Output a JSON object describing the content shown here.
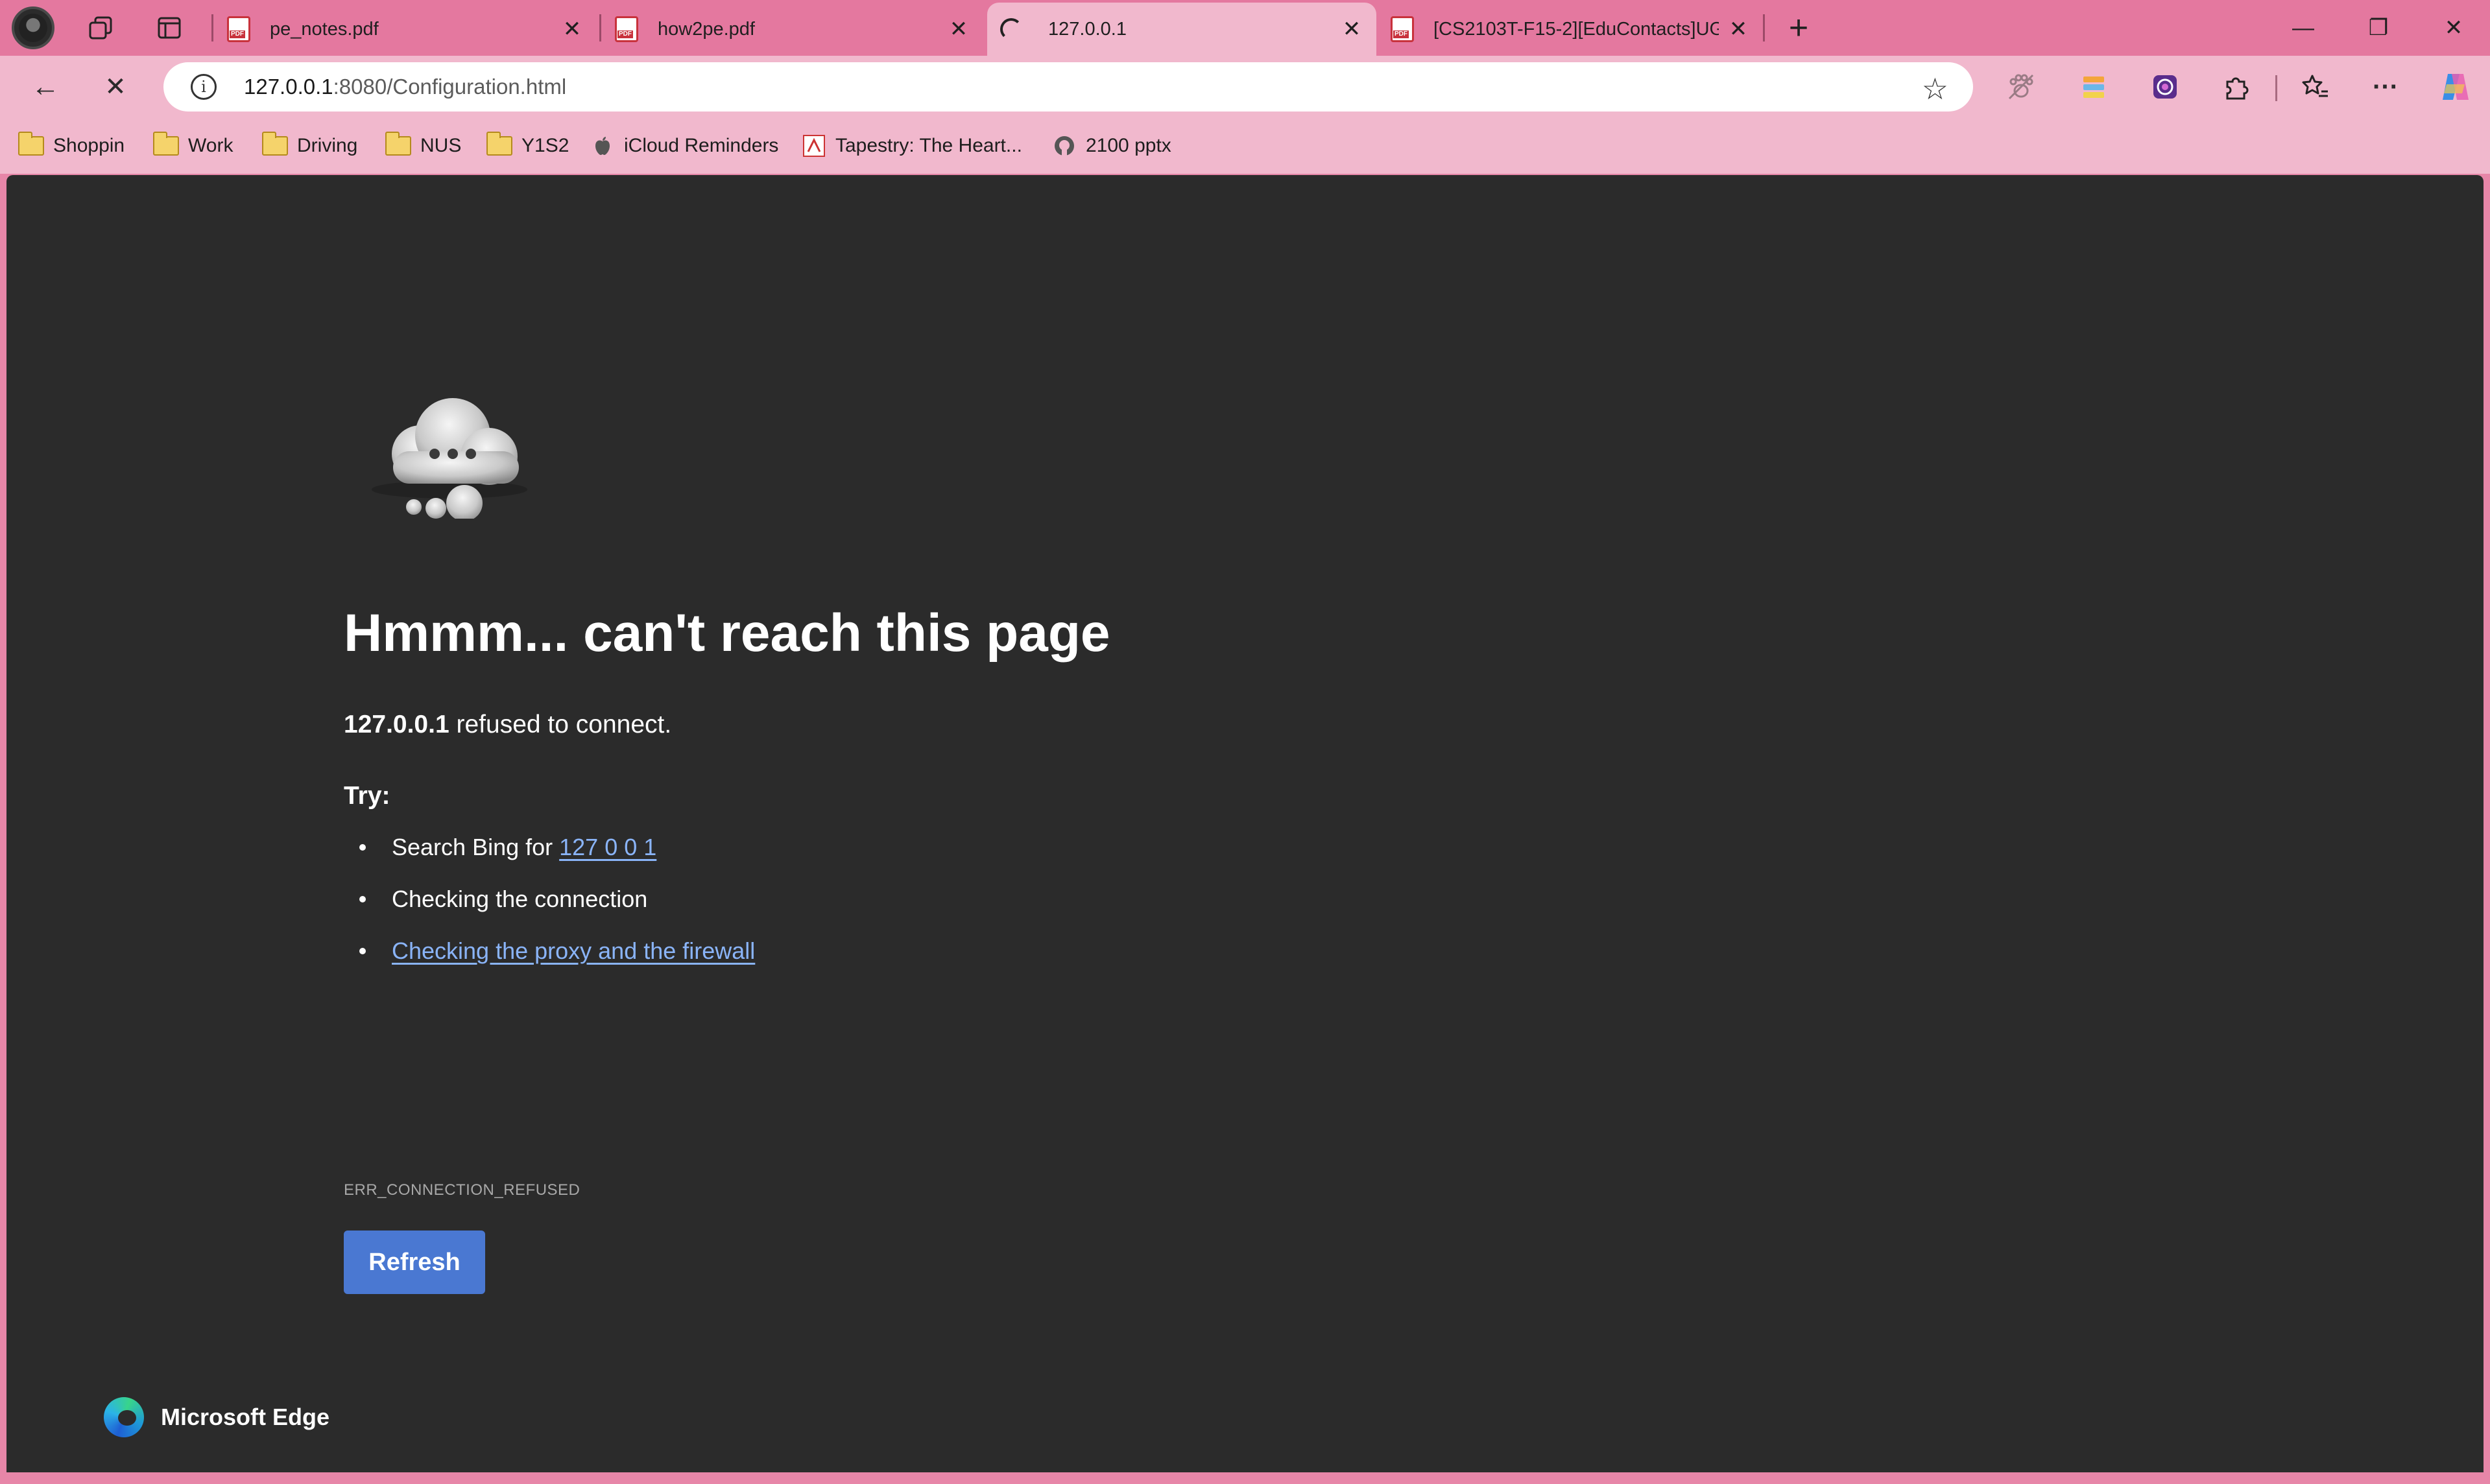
{
  "tabs": [
    {
      "title": "pe_notes.pdf",
      "icon": "pdf-icon"
    },
    {
      "title": "how2pe.pdf",
      "icon": "pdf-icon"
    },
    {
      "title": "127.0.0.1",
      "icon": "loading-spinner",
      "active": true
    },
    {
      "title": "[CS2103T-F15-2][EduContacts]UG",
      "icon": "pdf-icon"
    }
  ],
  "tab_close_glyph": "✕",
  "new_tab_glyph": "+",
  "window_controls": {
    "minimize": "—",
    "restore": "❐",
    "close": "✕"
  },
  "toolbar": {
    "back_glyph": "←",
    "stop_glyph": "✕",
    "url_host": "127.0.0.1",
    "url_path": ":8080/Configuration.html",
    "favorite_glyph": "☆",
    "more_glyph": "···"
  },
  "bookmarks": [
    {
      "label": "Shoppin",
      "icon": "folder-icon"
    },
    {
      "label": "Work",
      "icon": "folder-icon"
    },
    {
      "label": "Driving",
      "icon": "folder-icon"
    },
    {
      "label": "NUS",
      "icon": "folder-icon"
    },
    {
      "label": "Y1S2",
      "icon": "folder-icon"
    },
    {
      "label": "iCloud Reminders",
      "icon": "apple-icon"
    },
    {
      "label": "Tapestry: The Heart...",
      "icon": "tapestry-icon"
    },
    {
      "label": "2100 pptx",
      "icon": "github-icon"
    }
  ],
  "error_page": {
    "title": "Hmmm... can't reach this page",
    "host": "127.0.0.1",
    "message": " refused to connect.",
    "try_label": "Try:",
    "suggestions": {
      "search_prefix": "Search Bing for ",
      "search_link": "127 0 0 1",
      "connection": "Checking the connection",
      "proxy_link": "Checking the proxy and the firewall"
    },
    "error_code": "ERR_CONNECTION_REFUSED",
    "refresh_label": "Refresh",
    "brand": "Microsoft Edge"
  },
  "colors": {
    "tabstrip": "#e4789f",
    "toolbar": "#f1b8cd",
    "content_bg": "#2b2b2b",
    "link": "#8ab4f8",
    "button": "#4a78d2"
  }
}
